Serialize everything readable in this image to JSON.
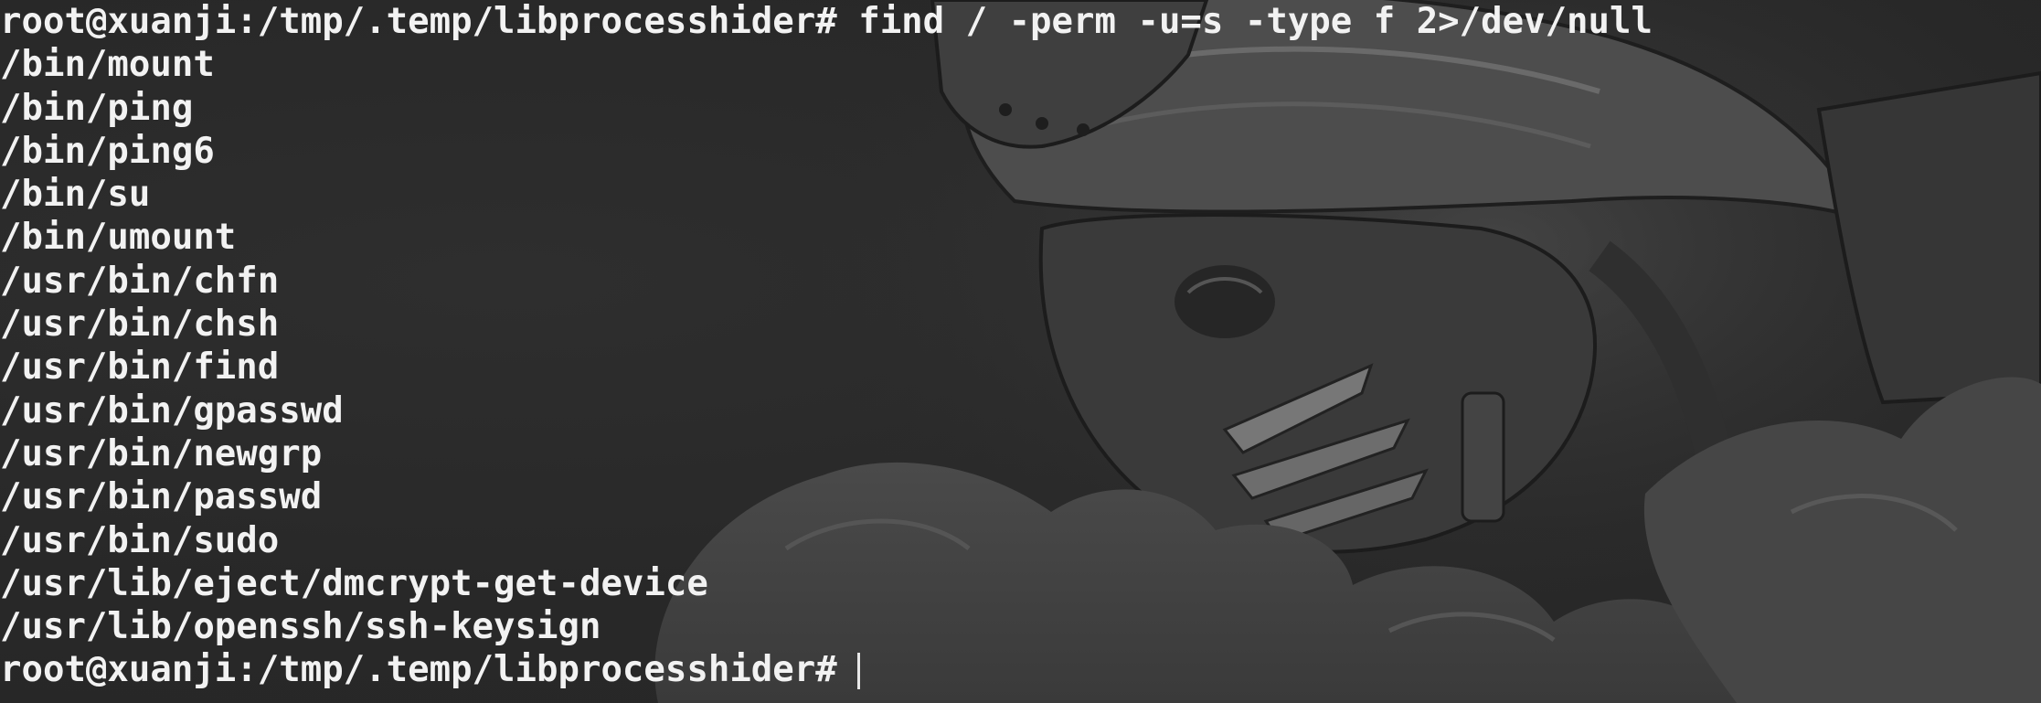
{
  "terminal": {
    "prompt": "root@xuanji:/tmp/.temp/libprocesshider#",
    "command": "find / -perm -u=s -type f 2>/dev/null",
    "output": [
      "/bin/mount",
      "/bin/ping",
      "/bin/ping6",
      "/bin/su",
      "/bin/umount",
      "/usr/bin/chfn",
      "/usr/bin/chsh",
      "/usr/bin/find",
      "/usr/bin/gpasswd",
      "/usr/bin/newgrp",
      "/usr/bin/passwd",
      "/usr/bin/sudo",
      "/usr/lib/eject/dmcrypt-get-device",
      "/usr/lib/openssh/ssh-keysign"
    ],
    "final_prompt": "root@xuanji:/tmp/.temp/libprocesshider#"
  },
  "colors": {
    "background": "#2b2b2b",
    "text": "#f2f2f2"
  },
  "wallpaper": {
    "subject": "masked-warrior-illustration"
  }
}
